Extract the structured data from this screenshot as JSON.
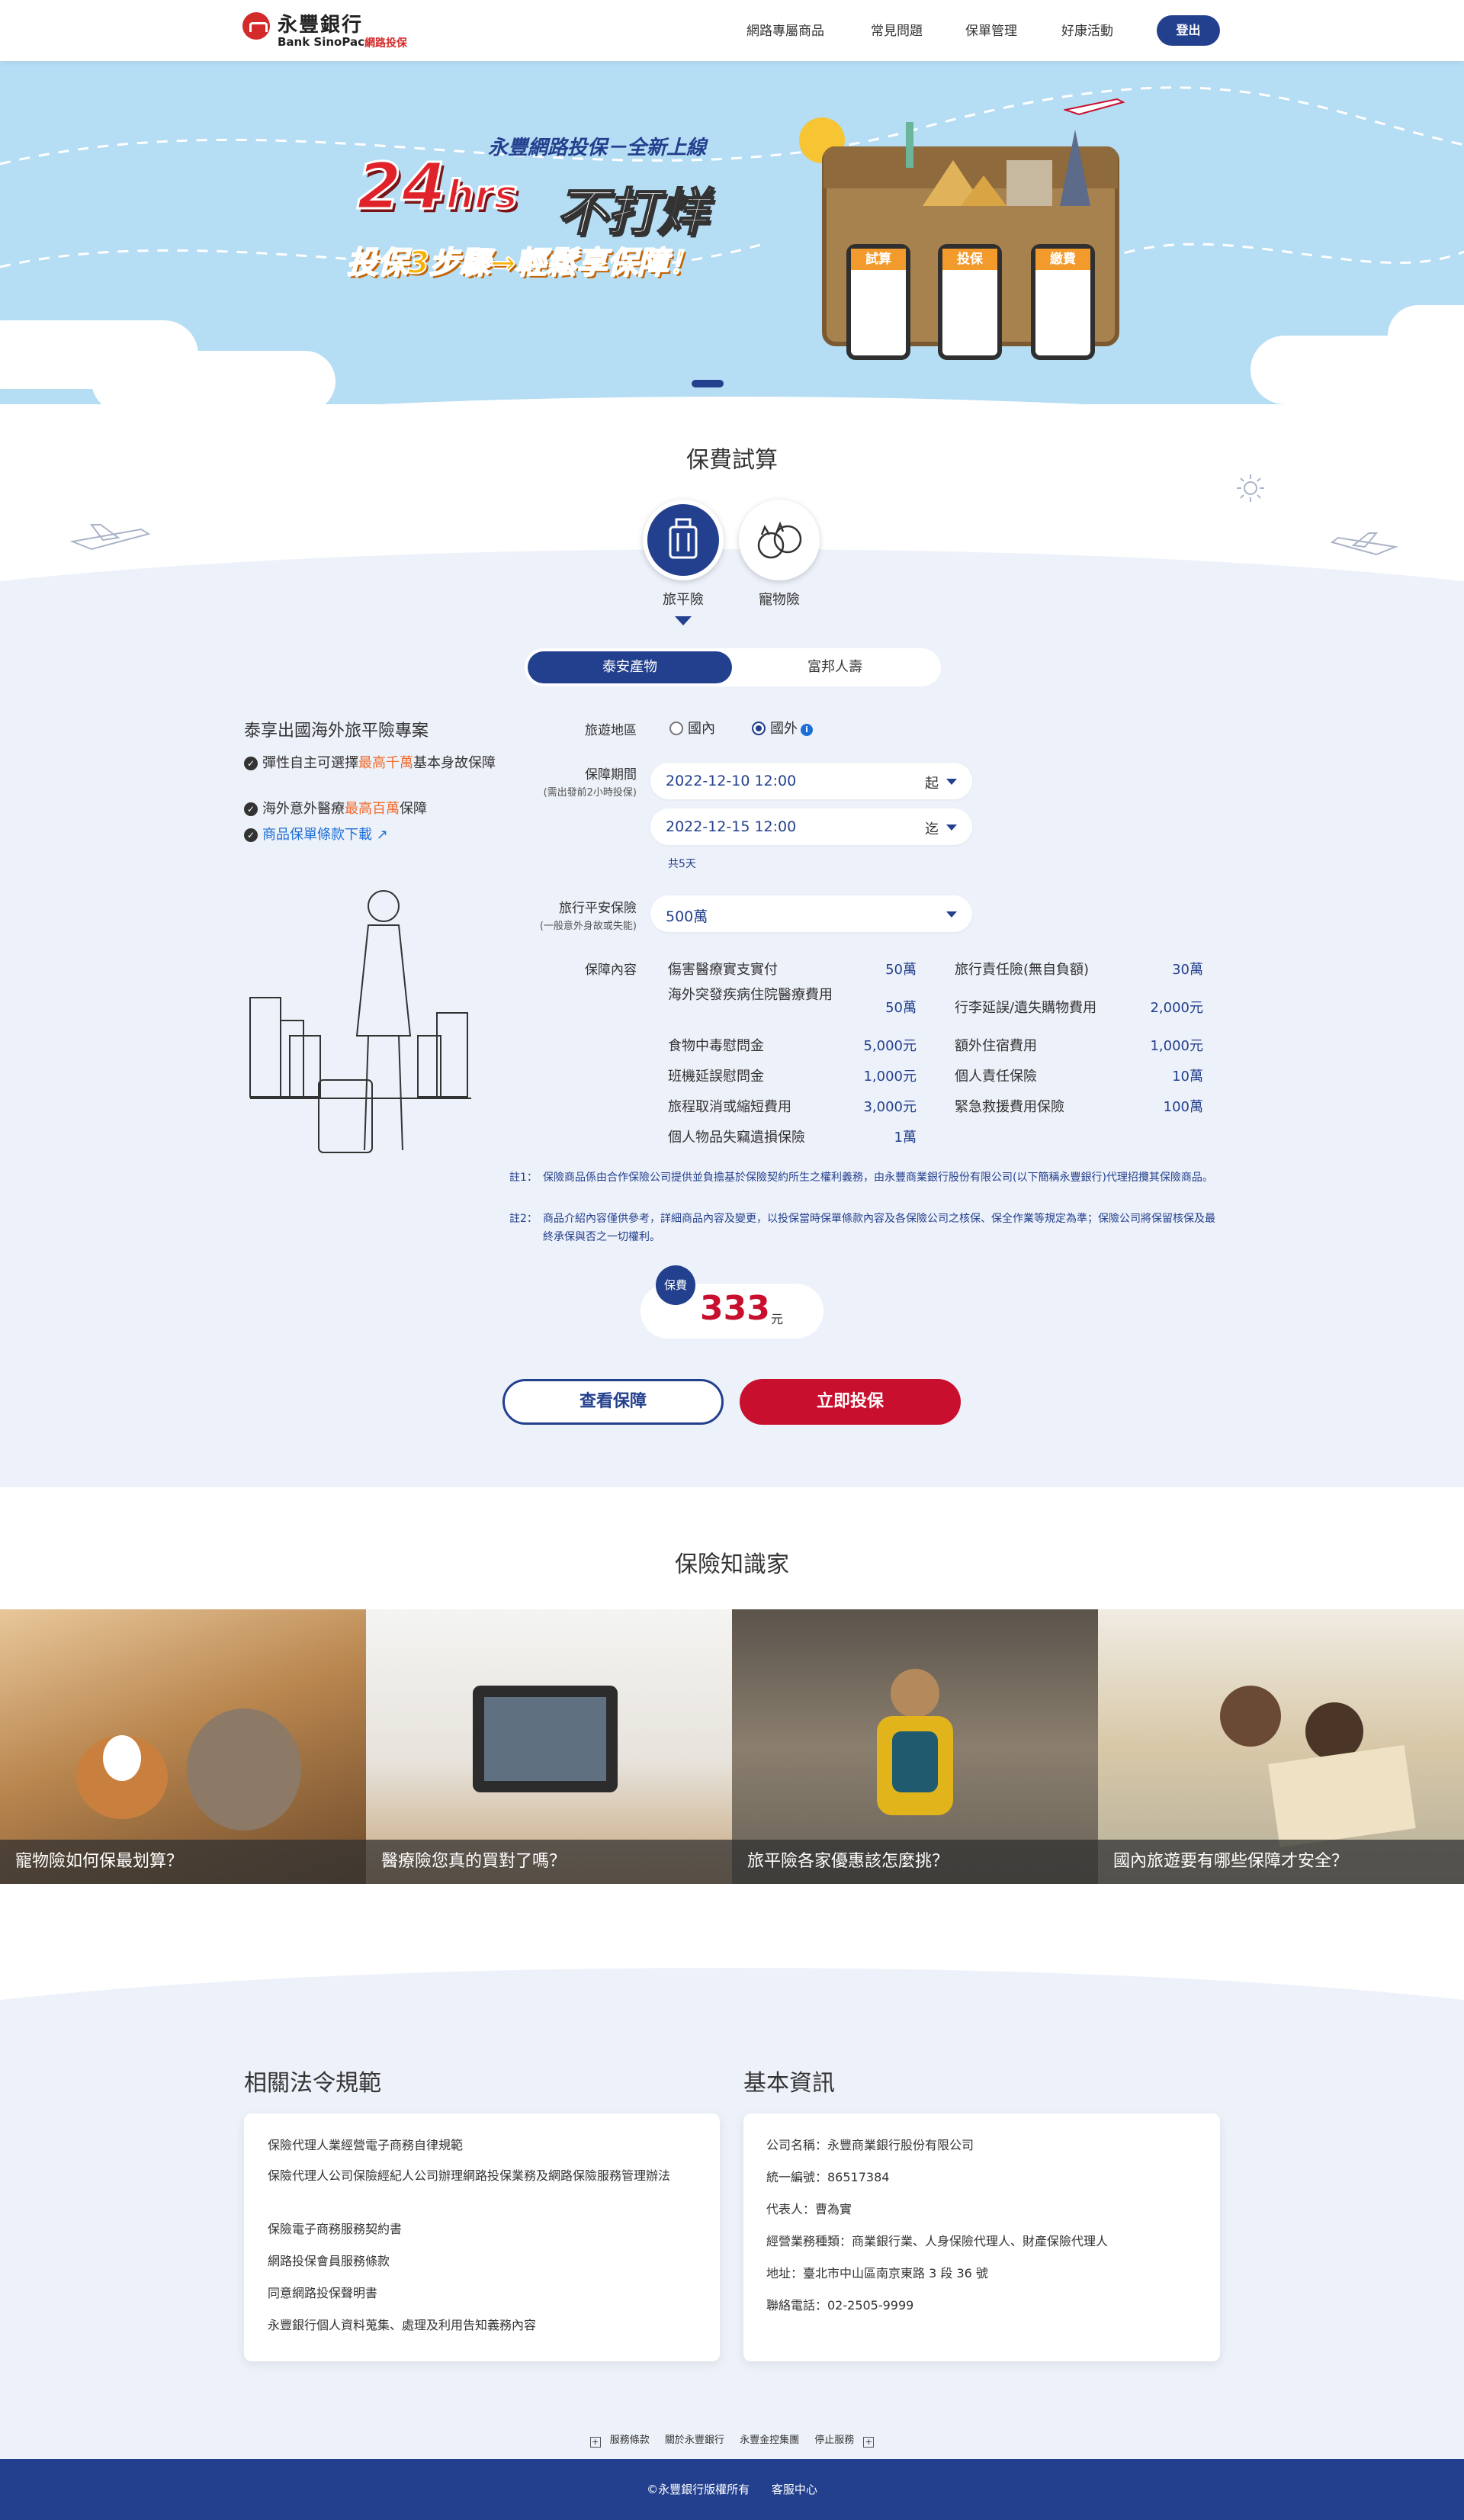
{
  "header": {
    "logo_zh": "永豐銀行",
    "logo_en": "Bank SinoPac",
    "logo_sub": "網路投保",
    "nav": [
      "網路專屬商品",
      "常見問題",
      "保單管理",
      "好康活動"
    ],
    "logout": "登出"
  },
  "hero": {
    "tagline": "永豐網路投保－全新上線",
    "headline_num": "24",
    "headline_unit": "hrs",
    "headline_text": "不打烊",
    "subline": "投保3步驟→輕鬆享保障！",
    "phones": [
      "試算",
      "投保",
      "繳費"
    ]
  },
  "calc": {
    "title": "保費試算",
    "tabs": [
      "旅平險",
      "寵物險"
    ],
    "companies": [
      "泰安產物",
      "富邦人壽"
    ],
    "plan": {
      "title": "泰享出國海外旅平險專案",
      "features": [
        {
          "a": "彈性自主可選擇",
          "b": "最高千萬",
          "c": "基本身故保障"
        },
        {
          "a": "海外意外醫療",
          "b": "最高百萬",
          "c": "保障"
        }
      ],
      "doc_link": "商品保單條款下載"
    },
    "form": {
      "region_label": "旅遊地區",
      "region_opt_1": "國內",
      "region_opt_2": "國外",
      "period_label": "保障期間",
      "period_sub": "(需出發前2小時投保)",
      "start": "2022-12-10 12:00",
      "start_suffix": "起",
      "end": "2022-12-15 12:00",
      "end_suffix": "迄",
      "days": "共5天",
      "sum_label": "旅行平安保險",
      "sum_sub": "(一般意外身故或失能)",
      "sum_value": "500萬",
      "coverage_label": "保障內容"
    },
    "coverage_left": [
      {
        "k": "傷害醫療實支實付",
        "v": "50萬"
      },
      {
        "k": "海外突發疾病住院醫療費用",
        "v": "50萬"
      },
      {
        "k": "食物中毒慰問金",
        "v": "5,000元"
      },
      {
        "k": "班機延誤慰問金",
        "v": "1,000元"
      },
      {
        "k": "旅程取消或縮短費用",
        "v": "3,000元"
      },
      {
        "k": "個人物品失竊遺損保險",
        "v": "1萬"
      }
    ],
    "coverage_right": [
      {
        "k": "旅行責任險(無自負額)",
        "v": "30萬"
      },
      {
        "k": "行李延誤/遺失購物費用",
        "v": "2,000元"
      },
      {
        "k": "額外住宿費用",
        "v": "1,000元"
      },
      {
        "k": "個人責任保險",
        "v": "10萬"
      },
      {
        "k": "緊急救援費用保險",
        "v": "100萬"
      }
    ],
    "note1_tag": "註1：",
    "note1": "保險商品係由合作保險公司提供並負擔基於保險契約所生之權利義務，由永豐商業銀行股份有限公司(以下簡稱永豐銀行)代理招攬其保險商品。",
    "note2_tag": "註2：",
    "note2": "商品介紹內容僅供參考，詳細商品內容及變更，以投保當時保單條款內容及各保險公司之核保、保全作業等規定為準；保險公司將保留核保及最終承保與否之一切權利。",
    "premium_label": "保費",
    "premium": "333",
    "premium_unit": "元",
    "btn_view": "查看保障",
    "btn_buy": "立即投保"
  },
  "knowledge": {
    "title": "保險知識家",
    "cards": [
      "寵物險如何保最划算？",
      "醫療險您真的買對了嗎？",
      "旅平險各家優惠該怎麼挑？",
      "國內旅遊要有哪些保障才安全？"
    ]
  },
  "laws": {
    "title": "相關法令規範",
    "items": [
      "保險代理人業經營電子商務自律規範",
      "保險代理人公司保險經紀人公司辦理網路投保業務及網路保險服務管理辦法",
      "保險電子商務服務契約書",
      "網路投保會員服務條款",
      "同意網路投保聲明書",
      "永豐銀行個人資料蒐集、處理及利用告知義務內容"
    ]
  },
  "basic": {
    "title": "基本資訊",
    "items": [
      "公司名稱：永豐商業銀行股份有限公司",
      "統一編號：86517384",
      "代表人：曹為實",
      "經營業務種類：商業銀行業、人身保險代理人、財產保險代理人",
      "地址：臺北市中山區南京東路 3 段 36 號",
      "聯絡電話：02-2505-9999"
    ]
  },
  "footer": {
    "links": [
      "服務條款",
      "關於永豐銀行",
      "永豐金控集團",
      "停止服務"
    ],
    "copyright": "©永豐銀行版權所有",
    "service": "客服中心"
  },
  "colors": {
    "brand": "#23408e",
    "accent": "#c8102e",
    "highlight": "#f16b2c"
  }
}
